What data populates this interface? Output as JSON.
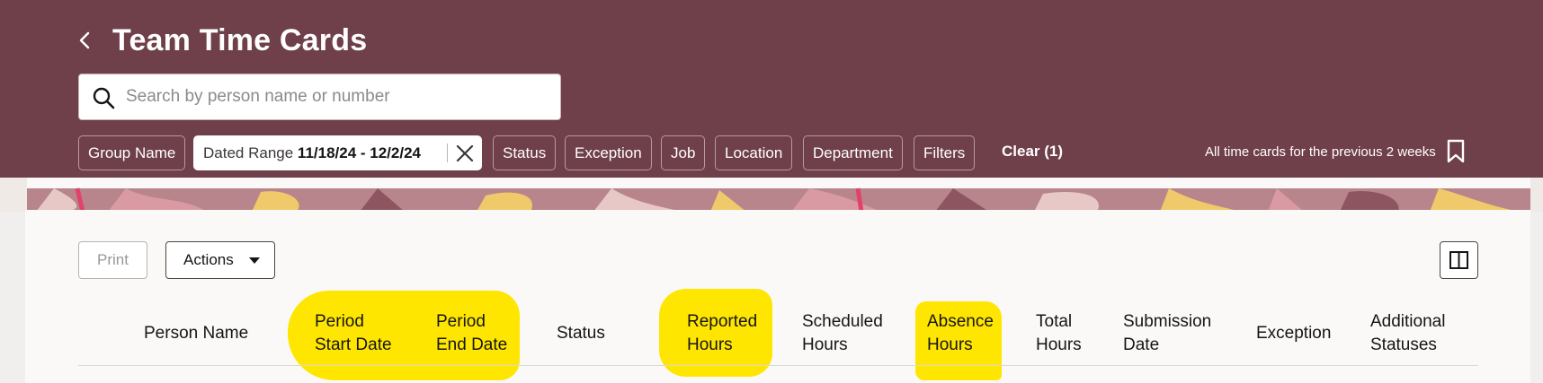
{
  "header": {
    "title": "Team Time Cards",
    "search_placeholder": "Search by person name or number",
    "saved_search_label": "All time cards for the previous 2 weeks"
  },
  "filters": {
    "group_name": "Group Name",
    "dated_range_label": "Dated Range",
    "dated_range_value": "11/18/24 - 12/2/24",
    "status": "Status",
    "exception": "Exception",
    "job": "Job",
    "location": "Location",
    "department": "Department",
    "filters": "Filters",
    "clear": "Clear (1)"
  },
  "toolbar": {
    "print_label": "Print",
    "actions_label": "Actions"
  },
  "table": {
    "columns": {
      "person_name": "Person Name",
      "period_start_1": "Period",
      "period_start_2": "Start Date",
      "period_end_1": "Period",
      "period_end_2": "End Date",
      "status": "Status",
      "reported_1": "Reported",
      "reported_2": "Hours",
      "scheduled_1": "Scheduled",
      "scheduled_2": "Hours",
      "absence_1": "Absence",
      "absence_2": "Hours",
      "total_1": "Total",
      "total_2": "Hours",
      "submission_1": "Submission",
      "submission_2": "Date",
      "exception": "Exception",
      "additional_1": "Additional",
      "additional_2": "Statuses"
    }
  },
  "colors": {
    "header_bg": "#6f3f4a",
    "highlight": "#ffe600",
    "card_bg": "#fbf9f8"
  }
}
